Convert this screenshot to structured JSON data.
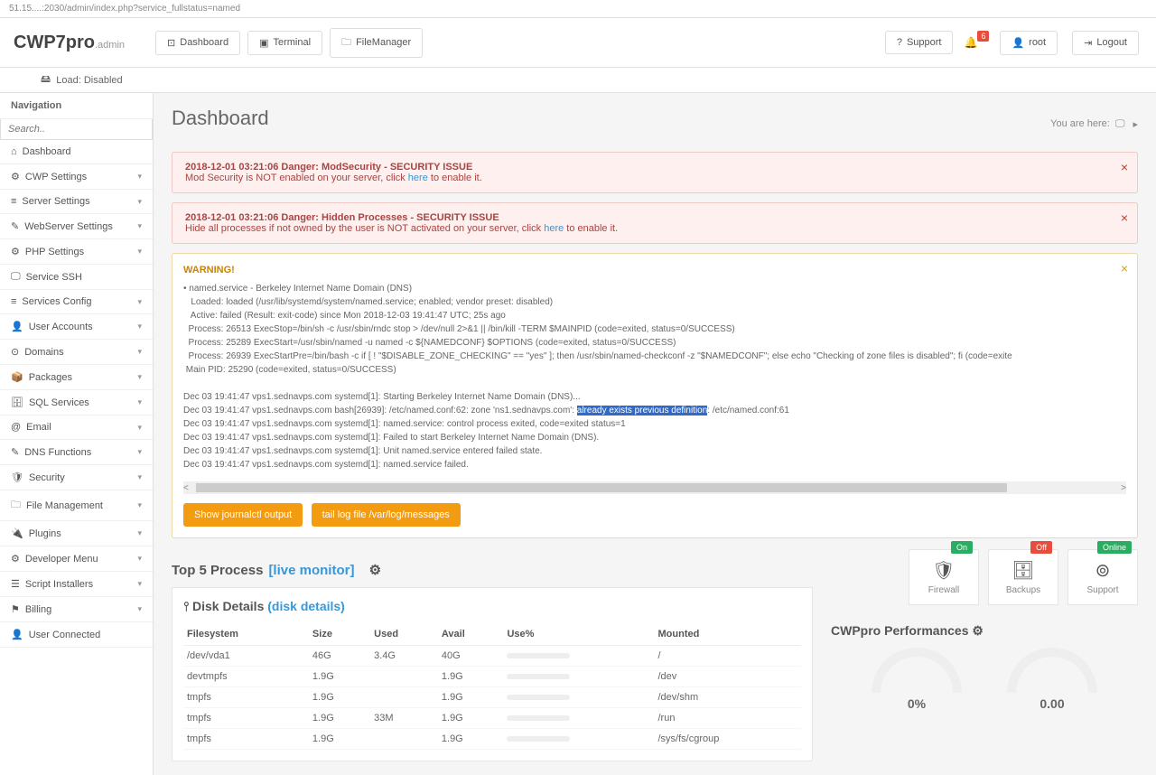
{
  "browser": {
    "url": "51.15....:2030/admin/index.php?service_fullstatus=named"
  },
  "logo": {
    "main": "CWP7pro",
    "sub": ".admin"
  },
  "header_buttons": {
    "dashboard": "Dashboard",
    "terminal": "Terminal",
    "filemanager": "FileManager"
  },
  "header_right": {
    "support": "Support",
    "badge": "6",
    "user": "root",
    "logout": "Logout"
  },
  "load": "Load: Disabled",
  "breadcrumb": "You are here: ",
  "page_title": "Dashboard",
  "nav_title": "Navigation",
  "search_placeholder": "Search..",
  "nav_items": [
    {
      "icon": "⌂",
      "label": "Dashboard",
      "chev": false
    },
    {
      "icon": "⚙",
      "label": "CWP Settings",
      "chev": true
    },
    {
      "icon": "≡",
      "label": "Server Settings",
      "chev": true
    },
    {
      "icon": "✎",
      "label": "WebServer Settings",
      "chev": true
    },
    {
      "icon": "⚙",
      "label": "PHP Settings",
      "chev": true
    },
    {
      "icon": "🖵",
      "label": "Service SSH",
      "chev": false
    },
    {
      "icon": "≡",
      "label": "Services Config",
      "chev": true
    },
    {
      "icon": "👤",
      "label": "User Accounts",
      "chev": true
    },
    {
      "icon": "⊙",
      "label": "Domains",
      "chev": true
    },
    {
      "icon": "📦",
      "label": "Packages",
      "chev": true
    },
    {
      "icon": "🗄",
      "label": "SQL Services",
      "chev": true
    },
    {
      "icon": "@",
      "label": "Email",
      "chev": true
    },
    {
      "icon": "✎",
      "label": "DNS Functions",
      "chev": true
    },
    {
      "icon": "🛡",
      "label": "Security",
      "chev": true
    },
    {
      "icon": "🗀",
      "label": "File Management",
      "chev": true
    },
    {
      "icon": "🔌",
      "label": "Plugins",
      "chev": true
    },
    {
      "icon": "⚙",
      "label": "Developer Menu",
      "chev": true
    },
    {
      "icon": "☰",
      "label": "Script Installers",
      "chev": true
    },
    {
      "icon": "⚑",
      "label": "Billing",
      "chev": true
    },
    {
      "icon": "👤",
      "label": "User Connected",
      "chev": false
    }
  ],
  "alert1": {
    "title": "2018-12-01 03:21:06 Danger: ModSecurity - SECURITY ISSUE",
    "text_a": "Mod Security is NOT enabled on your server, click ",
    "link": "here",
    "text_b": " to enable it."
  },
  "alert2": {
    "title": "2018-12-01 03:21:06 Danger: Hidden Processes - SECURITY ISSUE",
    "text_a": "Hide all processes if not owned by the user is NOT activated on your server, click ",
    "link": "here",
    "text_b": " to enable it."
  },
  "warning": {
    "title": "WARNING!",
    "log_pre": "• named.service - Berkeley Internet Name Domain (DNS)\n   Loaded: loaded (/usr/lib/systemd/system/named.service; enabled; vendor preset: disabled)\n   Active: failed (Result: exit-code) since Mon 2018-12-03 19:41:47 UTC; 25s ago\n  Process: 26513 ExecStop=/bin/sh -c /usr/sbin/rndc stop > /dev/null 2>&1 || /bin/kill -TERM $MAINPID (code=exited, status=0/SUCCESS)\n  Process: 25289 ExecStart=/usr/sbin/named -u named -c ${NAMEDCONF} $OPTIONS (code=exited, status=0/SUCCESS)\n  Process: 26939 ExecStartPre=/bin/bash -c if [ ! \"$DISABLE_ZONE_CHECKING\" == \"yes\" ]; then /usr/sbin/named-checkconf -z \"$NAMEDCONF\"; else echo \"Checking of zone files is disabled\"; fi (code=exite\n Main PID: 25290 (code=exited, status=0/SUCCESS)\n\nDec 03 19:41:47 vps1.sednavps.com systemd[1]: Starting Berkeley Internet Name Domain (DNS)...",
    "log_line_hl_a": "Dec 03 19:41:47 vps1.sednavps.com bash[26939]: /etc/named.conf:62: zone 'ns1.sednavps.com': ",
    "log_line_hl_mid": "already exists previous definition",
    "log_line_hl_b": ": /etc/named.conf:61",
    "log_post": "Dec 03 19:41:47 vps1.sednavps.com systemd[1]: named.service: control process exited, code=exited status=1\nDec 03 19:41:47 vps1.sednavps.com systemd[1]: Failed to start Berkeley Internet Name Domain (DNS).\nDec 03 19:41:47 vps1.sednavps.com systemd[1]: Unit named.service entered failed state.\nDec 03 19:41:47 vps1.sednavps.com systemd[1]: named.service failed.",
    "btn1": "Show journalctl output",
    "btn2": "tail log file /var/log/messages"
  },
  "top5": {
    "label": "Top 5 Process ",
    "link": "[live monitor]"
  },
  "disk": {
    "title": "Disk Details ",
    "link": "(disk details)",
    "headers": [
      "Filesystem",
      "Size",
      "Used",
      "Avail",
      "Use%",
      "Mounted"
    ],
    "rows": [
      {
        "fs": "/dev/vda1",
        "size": "46G",
        "used": "3.4G",
        "avail": "40G",
        "pct": 8,
        "mount": "/"
      },
      {
        "fs": "devtmpfs",
        "size": "1.9G",
        "used": "",
        "avail": "1.9G",
        "pct": 0,
        "mount": "/dev"
      },
      {
        "fs": "tmpfs",
        "size": "1.9G",
        "used": "",
        "avail": "1.9G",
        "pct": 0,
        "mount": "/dev/shm"
      },
      {
        "fs": "tmpfs",
        "size": "1.9G",
        "used": "33M",
        "avail": "1.9G",
        "pct": 1,
        "mount": "/run"
      },
      {
        "fs": "tmpfs",
        "size": "1.9G",
        "used": "",
        "avail": "1.9G",
        "pct": 0,
        "mount": "/sys/fs/cgroup"
      }
    ]
  },
  "stats": {
    "firewall": {
      "label": "Firewall",
      "tag": "On"
    },
    "backups": {
      "label": "Backups",
      "tag": "Off"
    },
    "support": {
      "label": "Support",
      "tag": "Online"
    }
  },
  "perf": {
    "title": "CWPpro Performances",
    "g1": "0%",
    "g2": "0.00"
  }
}
